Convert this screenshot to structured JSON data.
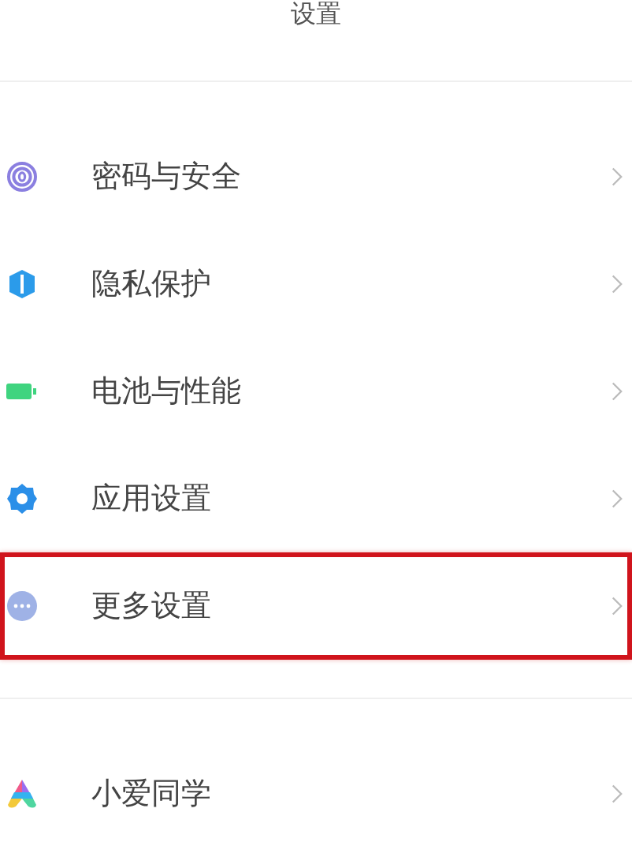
{
  "title": "设置",
  "groups": [
    {
      "items": [
        {
          "label": "密码与安全",
          "kind": "fingerprint",
          "highlighted": false
        },
        {
          "label": "隐私保护",
          "kind": "shield",
          "highlighted": false
        },
        {
          "label": "电池与性能",
          "kind": "battery",
          "highlighted": false
        },
        {
          "label": "应用设置",
          "kind": "gear",
          "highlighted": false
        },
        {
          "label": "更多设置",
          "kind": "more",
          "highlighted": true
        }
      ]
    },
    {
      "items": [
        {
          "label": "小爱同学",
          "kind": "assistant",
          "highlighted": false
        }
      ]
    }
  ]
}
